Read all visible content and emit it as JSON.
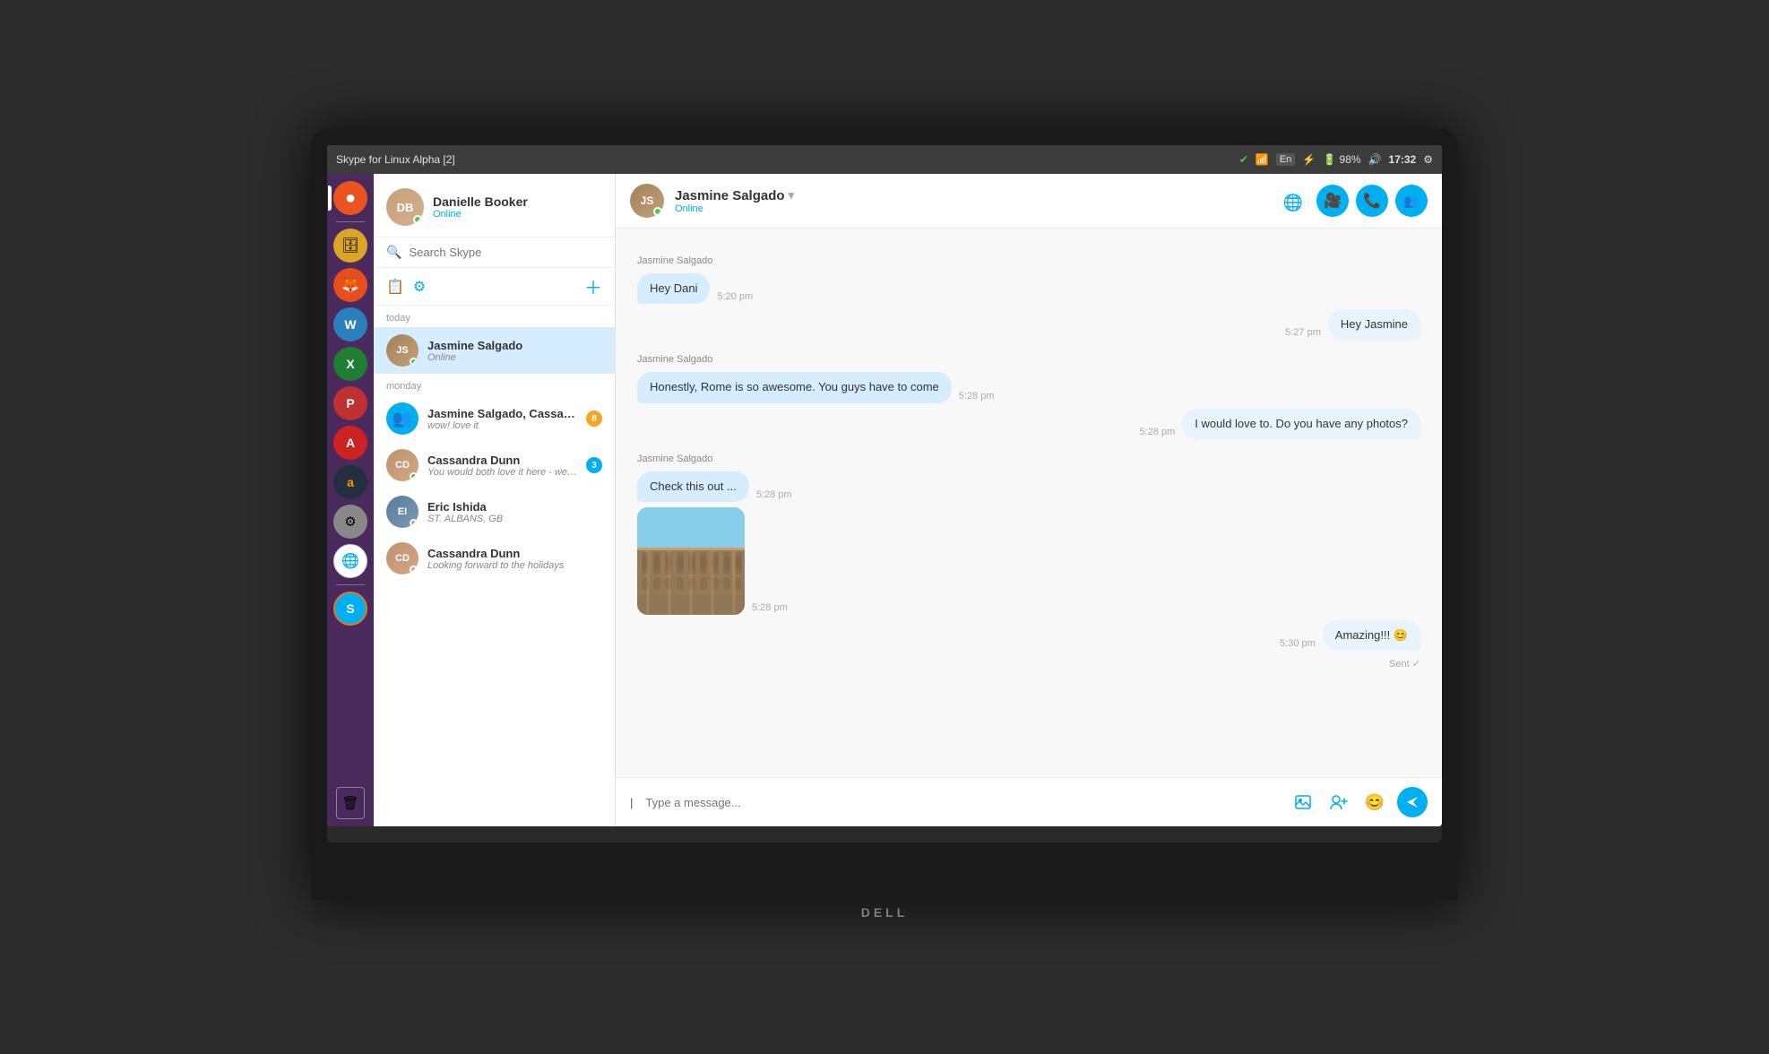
{
  "system": {
    "title": "Skype for Linux Alpha [2]",
    "time": "17:32",
    "battery": "98%",
    "battery_icon": "🔋",
    "volume_icon": "🔊",
    "wifi_icon": "📶",
    "bluetooth_icon": "𝔅",
    "lang": "En"
  },
  "sidebar": {
    "icons": [
      {
        "name": "ubuntu-icon",
        "label": "Ubuntu",
        "glyph": "🔴"
      },
      {
        "name": "files-icon",
        "label": "Files",
        "glyph": "📁"
      },
      {
        "name": "firefox-icon",
        "label": "Firefox",
        "glyph": "🦊"
      },
      {
        "name": "writer-icon",
        "label": "LibreOffice Writer",
        "glyph": "📝"
      },
      {
        "name": "calc-icon",
        "label": "LibreOffice Calc",
        "glyph": "📊"
      },
      {
        "name": "impress-icon",
        "label": "LibreOffice Impress",
        "glyph": "📑"
      },
      {
        "name": "apps-icon",
        "label": "Apps",
        "glyph": "A"
      },
      {
        "name": "amazon-icon",
        "label": "Amazon",
        "glyph": "a"
      },
      {
        "name": "settings-icon",
        "label": "Settings",
        "glyph": "⚙"
      },
      {
        "name": "chrome-icon",
        "label": "Chrome",
        "glyph": "●"
      },
      {
        "name": "skype-icon",
        "label": "Skype",
        "glyph": "S"
      },
      {
        "name": "trash-icon",
        "label": "Trash",
        "glyph": "🗑"
      }
    ]
  },
  "profile": {
    "name": "Danielle Booker",
    "status": "Online",
    "initials": "DB"
  },
  "search": {
    "placeholder": "Search Skype"
  },
  "contacts": {
    "today_label": "today",
    "today_items": [
      {
        "name": "Jasmine Salgado",
        "status": "Online",
        "preview": "Online",
        "avatar_initials": "JS",
        "dot": "green",
        "active": true
      }
    ],
    "monday_label": "Monday",
    "monday_items": [
      {
        "name": "Jasmine Salgado, Cassan...",
        "preview": "wow! love it",
        "avatar_type": "group",
        "badge": "8"
      },
      {
        "name": "Cassandra Dunn",
        "preview": "You would both love it here - we're havin...",
        "avatar_initials": "CD",
        "dot": "green",
        "badge": "3"
      },
      {
        "name": "Eric Ishida",
        "preview": "ST. ALBANS, GB",
        "avatar_initials": "EI",
        "dot": "gray"
      },
      {
        "name": "Cassandra Dunn",
        "preview": "Looking forward to the holidays",
        "avatar_initials": "CD",
        "dot": "gray"
      }
    ]
  },
  "chat": {
    "contact_name": "Jasmine Salgado",
    "contact_status": "Online",
    "avatar_initials": "JS",
    "messages": [
      {
        "id": 1,
        "sender": "Jasmine Salgado",
        "text": "Hey Dani",
        "time": "5:20 pm",
        "is_mine": false
      },
      {
        "id": 2,
        "sender": "me",
        "text": "Hey Jasmine",
        "time": "5:27 pm",
        "is_mine": true
      },
      {
        "id": 3,
        "sender": "Jasmine Salgado",
        "text": "Honestly, Rome is so awesome. You guys have to come",
        "time": "5:28 pm",
        "is_mine": false
      },
      {
        "id": 4,
        "sender": "me",
        "text": "I would love to. Do you have any photos?",
        "time": "5:28 pm",
        "is_mine": true
      },
      {
        "id": 5,
        "sender": "Jasmine Salgado",
        "text": "Check this out ...",
        "time": "5:28 pm",
        "is_mine": false
      },
      {
        "id": 6,
        "sender": "Jasmine Salgado",
        "type": "photo",
        "time": "5:28 pm",
        "is_mine": false
      },
      {
        "id": 7,
        "sender": "me",
        "text": "Amazing!!! 😊",
        "time": "5:30 pm",
        "is_mine": true,
        "status": "Sent"
      }
    ],
    "input_placeholder": "Type a message...",
    "actions": {
      "file_icon": "📎",
      "people_icon": "👥",
      "emoji_icon": "😊",
      "send_icon": "➤"
    }
  }
}
